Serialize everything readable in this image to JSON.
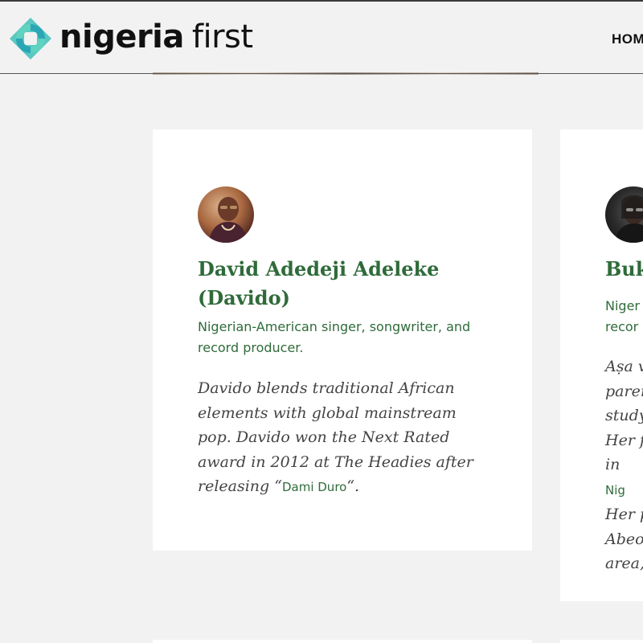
{
  "header": {
    "logo_word1": "nigeria",
    "logo_word2": "first",
    "nav_home": "HOM"
  },
  "colors": {
    "accent_green": "#2f6b3a",
    "logo_teal": "#3fbfb8",
    "background": "#f2f2f2"
  },
  "cards": [
    {
      "name": "David Adedeji Adeleke (Davido)",
      "role": "Nigerian-American singer, songwriter, and record producer.",
      "bio_text": "Davido blends traditional African elements with global mainstream pop. Davido won the Next Rated award in 2012 at The Headies after releasing “",
      "bio_link": "Dami Duro",
      "bio_end": "“."
    },
    {
      "name": "Buk",
      "role_lines": [
        "Niger",
        "recor"
      ],
      "bio_lines": [
        "Aṣa v",
        "parer",
        "study",
        "Her f",
        "in",
        "Her p",
        "Abeo",
        "area,"
      ],
      "bio_link": "Nig"
    }
  ]
}
